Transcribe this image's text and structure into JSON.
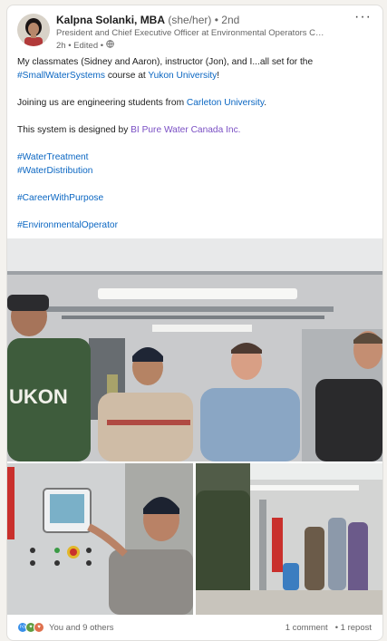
{
  "author": {
    "name": "Kalpna Solanki, MBA",
    "pronouns": "(she/her)",
    "degree": "• 2nd",
    "headline": "President and Chief Executive Officer at Environmental Operators Certific...",
    "meta": "2h • Edited •",
    "globe_icon": "globe-icon"
  },
  "more_menu": "···",
  "post": {
    "line1_a": "My classmates (Sidney and Aaron), instructor (Jon), and I...all set for the",
    "line1_tag": "#SmallWaterSystems",
    "line1_b": " course at ",
    "line1_link": "Yukon University",
    "line1_end": "!",
    "line2_a": "Joining us are engineering students from ",
    "line2_link": "Carleton University",
    "line2_end": ".",
    "line3_a": "This system is designed by ",
    "line3_link": "BI Pure Water Canada Inc.",
    "tags1": [
      "#WaterTreatment",
      "#WaterDistribution"
    ],
    "tag2": "#CareerWithPurpose",
    "tag3": "#EnvironmentalOperator"
  },
  "images": {
    "jacket_text": "UKON"
  },
  "footer": {
    "reactions_label": "You and 9 others",
    "comments": "1 comment",
    "reposts": "• 1 repost",
    "reaction_icons": [
      "like-icon",
      "celebrate-icon",
      "love-icon"
    ],
    "reaction_colors": [
      "#378fe9",
      "#5f9b41",
      "#df704d"
    ]
  }
}
